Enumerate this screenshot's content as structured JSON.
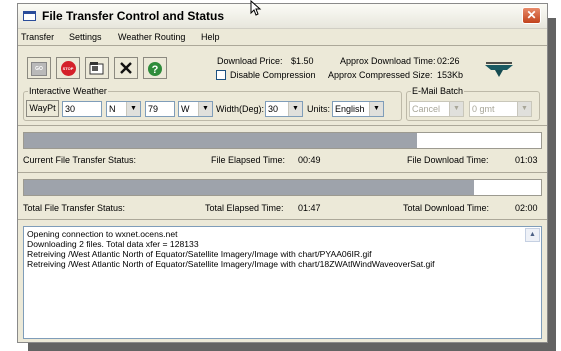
{
  "window": {
    "title": "File Transfer Control and Status",
    "close_glyph": "✕"
  },
  "menu": [
    "Transfer",
    "Settings",
    "Weather Routing",
    "Help"
  ],
  "toolbar": {
    "go_label": "GO",
    "stop_label": "STOP",
    "icons": [
      "go-icon",
      "stop-icon",
      "properties-icon",
      "cancel-x-icon",
      "help-icon"
    ]
  },
  "download": {
    "price_label": "Download Price:",
    "price_value": "$1.50",
    "approx_time_label": "Approx Download Time:",
    "approx_time_value": "02:26",
    "disable_compression_label": "Disable Compression",
    "compressed_label": "Approx Compressed Size:",
    "compressed_value": "153Kb"
  },
  "interactive": {
    "legend": "Interactive Weather",
    "waypt_button": "WayPt",
    "lat_value": "30",
    "lat_dir": "N",
    "lon_value": "79",
    "lon_dir": "W",
    "width_label": "Width(Deg):",
    "width_value": "30",
    "units_label": "Units:",
    "units_value": "English"
  },
  "email": {
    "legend": "E-Mail Batch",
    "cancel_label": "Cancel",
    "gmt_value": "0 gmt"
  },
  "current": {
    "status_label": "Current File Transfer Status:",
    "elapsed_label": "File Elapsed Time:",
    "elapsed_value": "00:49",
    "download_label": "File Download Time:",
    "download_value": "01:03",
    "progress": 0.76
  },
  "total": {
    "status_label": "Total File Transfer Status:",
    "elapsed_label": "Total Elapsed Time:",
    "elapsed_value": "01:47",
    "download_label": "Total Download Time:",
    "download_value": "02:00",
    "progress": 0.87
  },
  "log": [
    "Opening connection to wxnet.ocens.net",
    "Downloading 2 files. Total data xfer = 128133",
    "Retreiving /West Atlantic North of Equator/Satellite Imagery/Image with chart/PYAA06IR.gif",
    "Retreiving /West Atlantic North of Equator/Satellite Imagery/Image with chart/18ZWAtlWindWaveoverSat.gif"
  ]
}
